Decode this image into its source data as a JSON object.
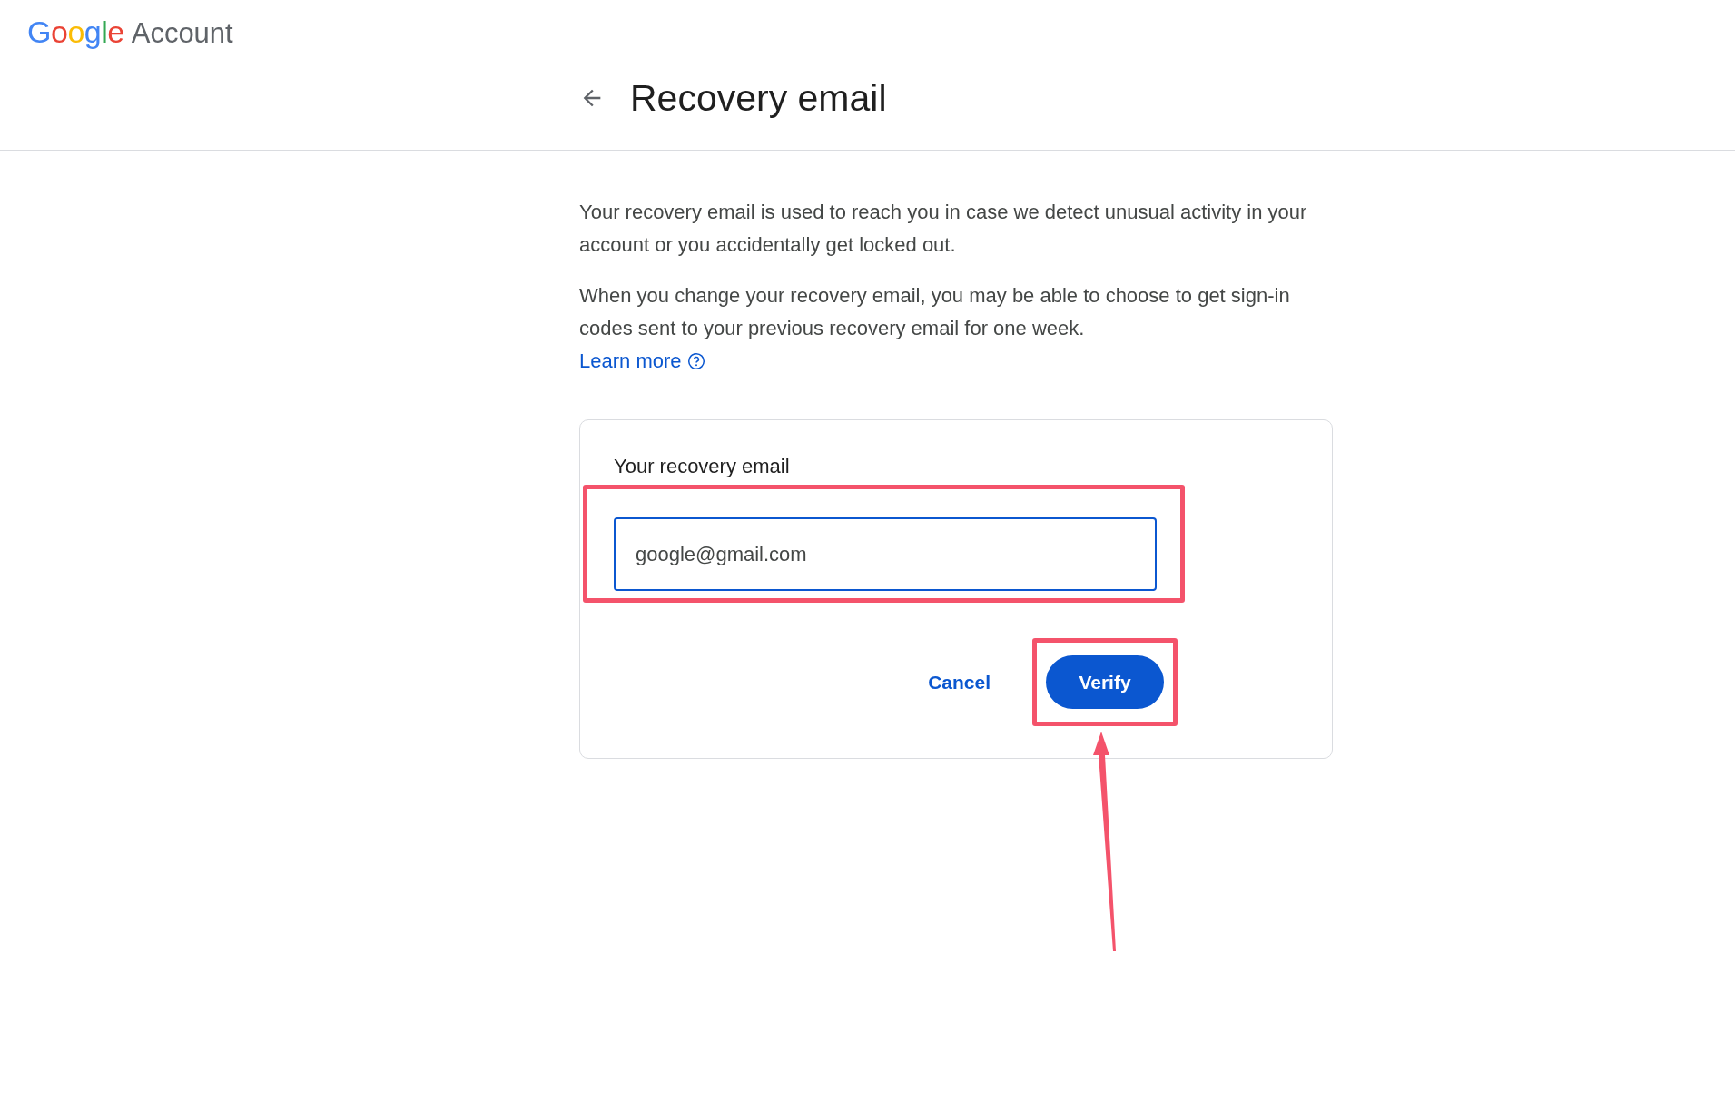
{
  "logo": {
    "brand": "Google",
    "product": "Account"
  },
  "page": {
    "title": "Recovery email"
  },
  "paragraphs": [
    "Your recovery email is used to reach you in case we detect unusual activity in your account or you accidentally get locked out.",
    "When you change your recovery email, you may be able to choose to get sign-in codes sent to your previous recovery email for one week."
  ],
  "learn_more": "Learn more",
  "form": {
    "label": "Your recovery email",
    "value": "google@gmail.com",
    "buttons": [
      {
        "label": "Cancel",
        "kind": "text"
      },
      {
        "label": "Verify",
        "kind": "filled"
      }
    ]
  }
}
